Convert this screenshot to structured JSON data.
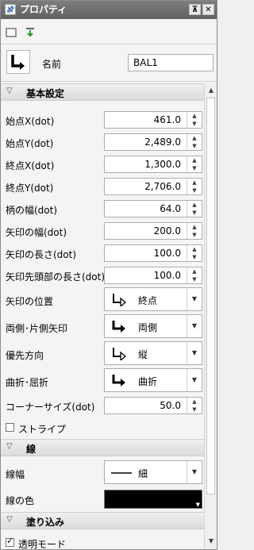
{
  "window": {
    "title": "プロパティ",
    "pin_label": "⊼",
    "close_label": "✕"
  },
  "name": {
    "label": "名前",
    "value": "BAL1"
  },
  "sections": {
    "basic": "基本設定",
    "line": "線",
    "fill": "塗り込み"
  },
  "fields": {
    "start_x": {
      "label": "始点X(dot)",
      "value": "461.0"
    },
    "start_y": {
      "label": "始点Y(dot)",
      "value": "2,489.0"
    },
    "end_x": {
      "label": "終点X(dot)",
      "value": "1,300.0"
    },
    "end_y": {
      "label": "終点Y(dot)",
      "value": "2,706.0"
    },
    "handle_width": {
      "label": "柄の幅(dot)",
      "value": "64.0"
    },
    "arrow_width": {
      "label": "矢印の幅(dot)",
      "value": "200.0"
    },
    "arrow_length": {
      "label": "矢印の長さ(dot)",
      "value": "100.0"
    },
    "arrow_head_length": {
      "label": "矢印先頭部の長さ(dot)",
      "value": "100.0"
    },
    "arrow_position": {
      "label": "矢印の位置",
      "value": "終点"
    },
    "arrow_sides": {
      "label": "両側･片側矢印",
      "value": "両側"
    },
    "priority_direction": {
      "label": "優先方向",
      "value": "縦"
    },
    "bend": {
      "label": "曲折･屈折",
      "value": "曲折"
    },
    "corner_size": {
      "label": "コーナーサイズ(dot)",
      "value": "50.0"
    },
    "stripe": {
      "label": "ストライプ",
      "checked": false
    },
    "line_width": {
      "label": "線幅",
      "value": "細"
    },
    "line_color": {
      "label": "線の色",
      "color": "#000000"
    },
    "transparent_mode": {
      "label": "透明モード",
      "checked": true
    }
  },
  "icons": {
    "title": "properties-icon",
    "toolbar": [
      "rectangle-icon",
      "download-icon"
    ],
    "shape": "bent-arrow-icon"
  },
  "colors": {
    "titlebar": "#6e6e6e",
    "panel": "#f4f4f4"
  }
}
